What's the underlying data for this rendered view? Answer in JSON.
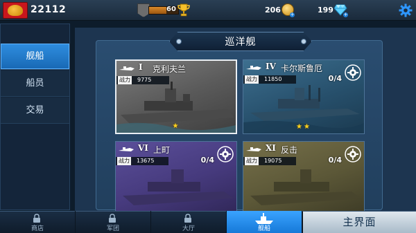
{
  "top_bar": {
    "player_power": "22112",
    "rank_value": "60",
    "rank_progress": 0.6,
    "coins": "206",
    "gems": "199",
    "icons": [
      "flag-icon",
      "rank-badge-icon",
      "trophy-icon",
      "gold-coin-icon",
      "diamond-icon",
      "settings-icon"
    ]
  },
  "sidebar": {
    "tabs": [
      {
        "label": "舰船",
        "active": true
      },
      {
        "label": "船员",
        "active": false
      },
      {
        "label": "交易",
        "active": false
      }
    ]
  },
  "panel": {
    "title": "巡洋舰",
    "power_label": "战力",
    "ships": [
      {
        "tier": "I",
        "name": "克利夫兰",
        "power": "9775",
        "progress": "",
        "stars": 1,
        "selected": true
      },
      {
        "tier": "IV",
        "name": "卡尔斯鲁厄",
        "power": "11850",
        "progress": "0/4",
        "stars": 2,
        "selected": false
      },
      {
        "tier": "VI",
        "name": "上町",
        "power": "13675",
        "progress": "0/4",
        "stars": 0,
        "selected": false
      },
      {
        "tier": "XI",
        "name": "反击",
        "power": "19075",
        "progress": "0/4",
        "stars": 0,
        "selected": false
      }
    ]
  },
  "bottom_nav": {
    "items": [
      {
        "label": "商店",
        "locked": true
      },
      {
        "label": "军团",
        "locked": true
      },
      {
        "label": "大厅",
        "locked": true
      },
      {
        "label": "舰船",
        "active": true
      }
    ],
    "main_button": "主界面"
  },
  "colors": {
    "accent_blue": "#2f8ee0",
    "gold": "#ffd21f",
    "flag_red": "#c8161d"
  }
}
